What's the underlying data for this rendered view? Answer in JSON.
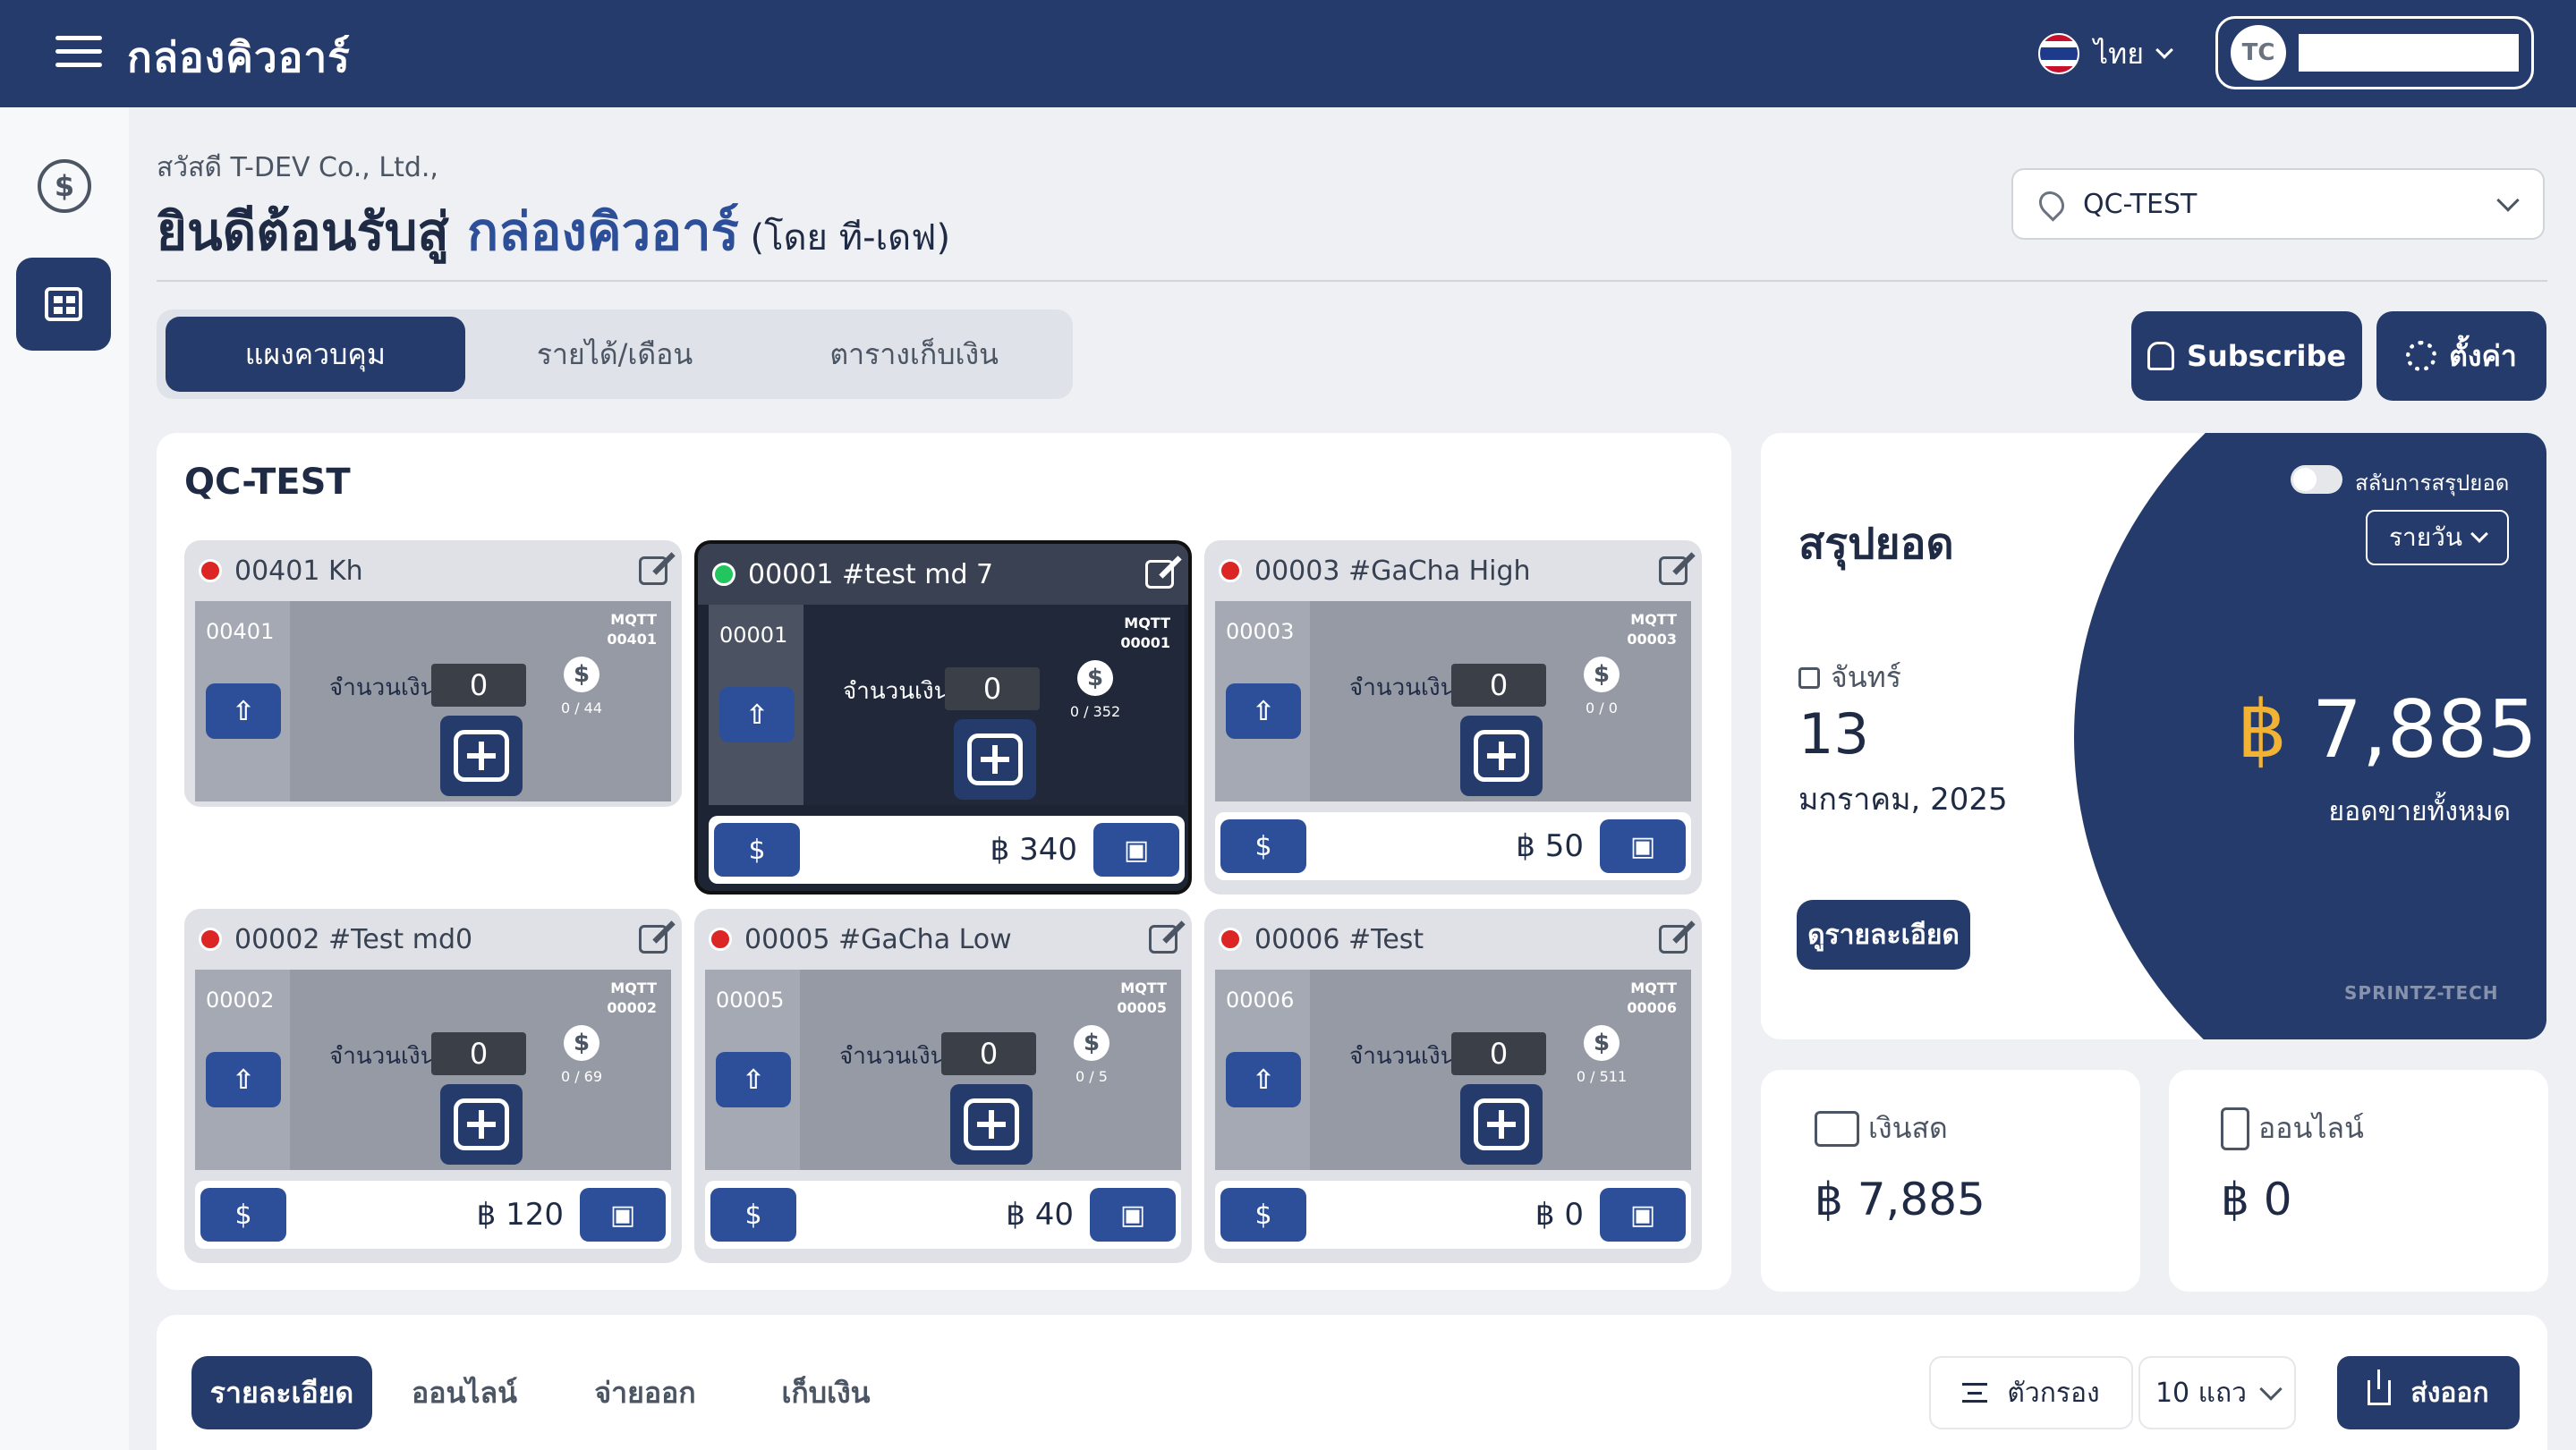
{
  "header": {
    "app_title": "กล่องคิวอาร์",
    "language": "ไทย",
    "user_initials": "TC"
  },
  "greeting": {
    "hello": "สวัสดี T-DEV Co., Ltd.,",
    "welcome_prefix": "ยินดีต้อนรับสู่ ",
    "welcome_brand": "กล่องคิวอาร์",
    "welcome_suffix": " (โดย ที-เดฟ)"
  },
  "location": {
    "selected": "QC-TEST"
  },
  "tabs": [
    {
      "label": "แผงควบคุม",
      "active": true
    },
    {
      "label": "รายได้/เดือน",
      "active": false
    },
    {
      "label": "ตารางเก็บเงิน",
      "active": false
    }
  ],
  "actions": {
    "subscribe": "Subscribe",
    "settings": "ตั้งค่า"
  },
  "panel": {
    "title": "QC-TEST"
  },
  "machines": [
    {
      "name": "00401 Kh",
      "code": "00401",
      "online": false,
      "amount_label": "จำนวนเงิน",
      "amount": "0",
      "mqtt": "MQTT",
      "mqtt_id": "00401",
      "coins": "0 / 44",
      "total": ""
    },
    {
      "name": "00001 #test md 7",
      "code": "00001",
      "online": true,
      "amount_label": "จำนวนเงิน",
      "amount": "0",
      "mqtt": "MQTT",
      "mqtt_id": "00001",
      "coins": "0 / 352",
      "total": "฿ 340"
    },
    {
      "name": "00003 #GaCha High",
      "code": "00003",
      "online": false,
      "amount_label": "จำนวนเงิน",
      "amount": "0",
      "mqtt": "MQTT",
      "mqtt_id": "00003",
      "coins": "0 / 0",
      "total": "฿ 50"
    },
    {
      "name": "00002 #Test md0",
      "code": "00002",
      "online": false,
      "amount_label": "จำนวนเงิน",
      "amount": "0",
      "mqtt": "MQTT",
      "mqtt_id": "00002",
      "coins": "0 / 69",
      "total": "฿ 120"
    },
    {
      "name": "00005 #GaCha Low",
      "code": "00005",
      "online": false,
      "amount_label": "จำนวนเงิน",
      "amount": "0",
      "mqtt": "MQTT",
      "mqtt_id": "00005",
      "coins": "0 / 5",
      "total": "฿ 40"
    },
    {
      "name": "00006 #Test",
      "code": "00006",
      "online": false,
      "amount_label": "จำนวนเงิน",
      "amount": "0",
      "mqtt": "MQTT",
      "mqtt_id": "00006",
      "coins": "0 / 511",
      "total": "฿ 0"
    }
  ],
  "summary": {
    "title": "สรุปยอด",
    "toggle_label": "สลับการสรุปยอด",
    "period": "รายวัน",
    "day": "จันทร์",
    "date": "13",
    "month_year": "มกราคม, 2025",
    "total_currency": "฿",
    "total_value": " 7,885",
    "total_label": "ยอดขายทั้งหมด",
    "details_button": "ดูรายละเอียด",
    "watermark": "SPRINTZ-TECH"
  },
  "cash": {
    "label": "เงินสด",
    "value": "฿ 7,885"
  },
  "online": {
    "label": "ออนไลน์",
    "value": "฿ 0"
  },
  "bottom": {
    "tabs": [
      "รายละเอียด",
      "ออนไลน์",
      "จ่ายออก",
      "เก็บเงิน"
    ],
    "filter": "ตัวกรอง",
    "rows": "10 แถว",
    "export": "ส่งออก"
  },
  "colors": {
    "primary": "#253b6b",
    "accent": "#f2b233",
    "offline": "#dc2626",
    "online": "#22c55e"
  }
}
